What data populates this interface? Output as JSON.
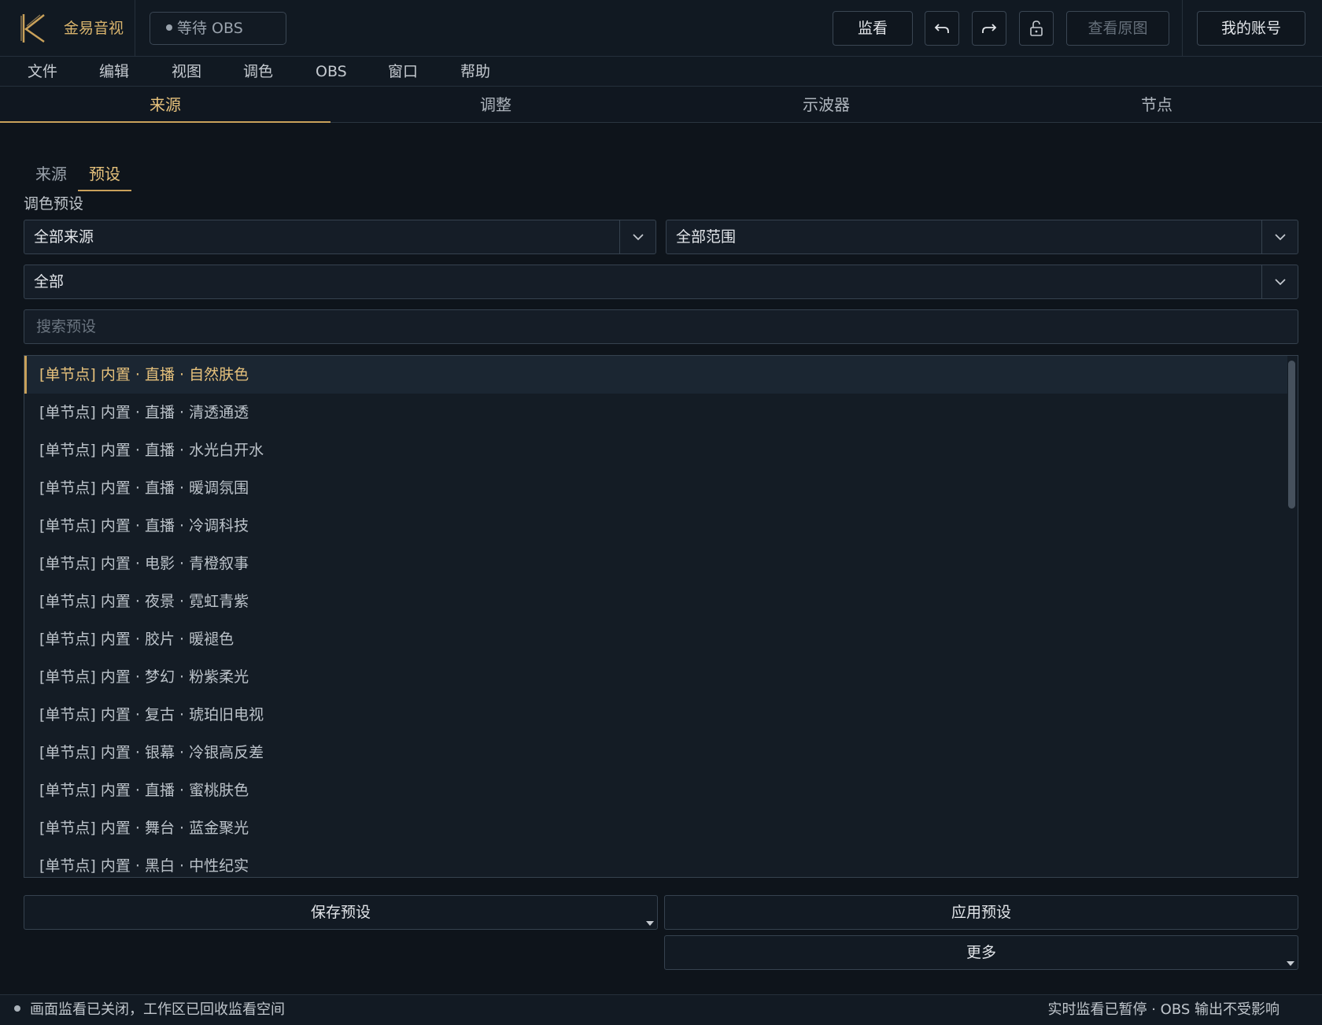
{
  "app": {
    "name": "金易音视",
    "obs_status": "等待 OBS"
  },
  "toolbar": {
    "monitor_label": "监看",
    "undo_icon": "undo-icon",
    "redo_icon": "redo-icon",
    "lock_icon": "unlock-icon",
    "view_original_label": "查看原图",
    "account_label": "我的账号"
  },
  "menu": [
    "文件",
    "编辑",
    "视图",
    "调色",
    "OBS",
    "窗口",
    "帮助"
  ],
  "main_tabs": [
    "来源",
    "调整",
    "示波器",
    "节点"
  ],
  "sub_tabs": [
    "来源",
    "预设"
  ],
  "section_label": "调色预设",
  "filters": {
    "source": "全部来源",
    "scope": "全部范围",
    "category": "全部"
  },
  "search": {
    "placeholder": "搜索预设",
    "value": ""
  },
  "presets": [
    "[单节点] 内置 · 直播 · 自然肤色",
    "[单节点] 内置 · 直播 · 清透通透",
    "[单节点] 内置 · 直播 · 水光白开水",
    "[单节点] 内置 · 直播 · 暖调氛围",
    "[单节点] 内置 · 直播 · 冷调科技",
    "[单节点] 内置 · 电影 · 青橙叙事",
    "[单节点] 内置 · 夜景 · 霓虹青紫",
    "[单节点] 内置 · 胶片 · 暖褪色",
    "[单节点] 内置 · 梦幻 · 粉紫柔光",
    "[单节点] 内置 · 复古 · 琥珀旧电视",
    "[单节点] 内置 · 银幕 · 冷银高反差",
    "[单节点] 内置 · 直播 · 蜜桃肤色",
    "[单节点] 内置 · 舞台 · 蓝金聚光",
    "[单节点] 内置 · 黑白 · 中性纪实"
  ],
  "selected_preset_index": 0,
  "actions": {
    "save_label": "保存预设",
    "apply_label": "应用预设",
    "more_label": "更多"
  },
  "status": {
    "left": "画面监看已关闭，工作区已回收监看空间",
    "right": "实时监看已暂停 · OBS 输出不受影响"
  },
  "colors": {
    "accent": "#c9a15a",
    "accent_text": "#e7c27c",
    "background": "#0e141b"
  }
}
